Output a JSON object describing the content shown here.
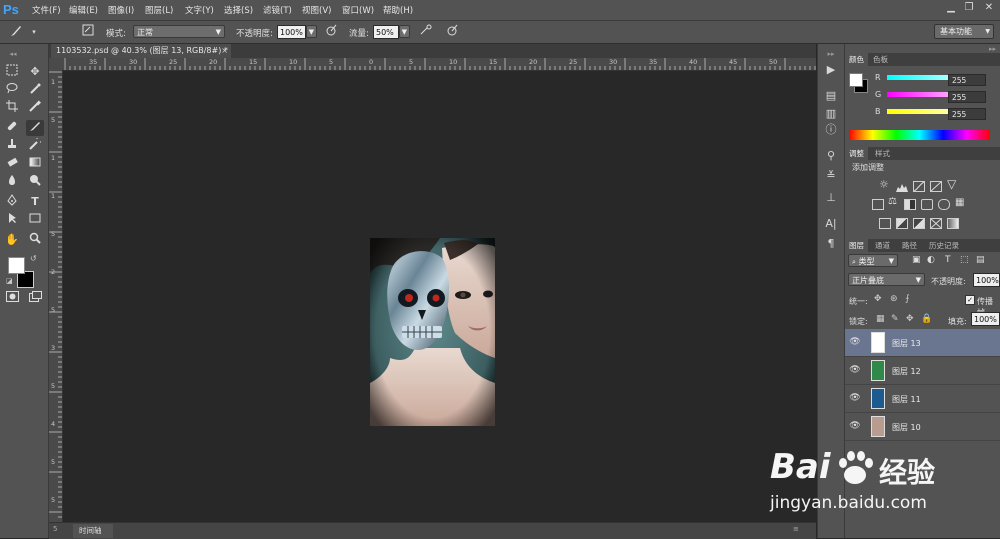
{
  "app": {
    "logo": "Ps"
  },
  "menu": [
    "文件(F)",
    "编辑(E)",
    "图像(I)",
    "图层(L)",
    "文字(Y)",
    "选择(S)",
    "滤镜(T)",
    "视图(V)",
    "窗口(W)",
    "帮助(H)"
  ],
  "window_controls": {
    "minimize": "▁",
    "restore": "❐",
    "close": "✕"
  },
  "options": {
    "brush_size": "57",
    "mode_label": "模式:",
    "mode_value": "正常",
    "opacity_label": "不透明度:",
    "opacity_value": "100%",
    "flow_label": "流量:",
    "flow_value": "50%",
    "workspace": "基本功能"
  },
  "document": {
    "tab_title": "1103532.psd @ 40.3% (图层 13, RGB/8#) *",
    "tab_close": "×",
    "ruler_h": [
      "35",
      "30",
      "25",
      "20",
      "15",
      "10",
      "5",
      "0",
      "5",
      "10",
      "15",
      "20",
      "25",
      "30",
      "35",
      "40",
      "45",
      "50"
    ],
    "ruler_v": [
      "1",
      "5",
      "1",
      "1",
      "5",
      "2",
      "5",
      "3",
      "5",
      "4",
      "5",
      "5"
    ],
    "timeline_label": "时间轴"
  },
  "color_panel": {
    "tabs": [
      "颜色",
      "色板"
    ],
    "channels": [
      {
        "label": "R",
        "value": "255"
      },
      {
        "label": "G",
        "value": "255"
      },
      {
        "label": "B",
        "value": "255"
      }
    ]
  },
  "adjust_panel": {
    "tabs": [
      "调整",
      "样式"
    ],
    "title": "添加调整"
  },
  "layers_panel": {
    "tabs": [
      "图层",
      "通道",
      "路径",
      "历史记录"
    ],
    "filter_kind": "类型",
    "blend_mode": "正片叠底",
    "opacity_label": "不透明度:",
    "opacity_value": "100%",
    "unify_label": "统一:",
    "propagate_label": "传播帧",
    "lock_label": "锁定:",
    "fill_label": "填充:",
    "fill_value": "100%",
    "layers": [
      {
        "name": "图层 13",
        "thumb": "#ffffff",
        "selected": true
      },
      {
        "name": "图层 12",
        "thumb": "#2f8a4a",
        "selected": false
      },
      {
        "name": "图层 11",
        "thumb": "#1d5a8f",
        "selected": false
      },
      {
        "name": "图层 10",
        "thumb": "#b89c90",
        "selected": false
      }
    ]
  },
  "watermark": {
    "brand": "Bai",
    "brand_cn": "经验",
    "url": "jingyan.baidu.com"
  },
  "colors": {
    "selected_layer": "#6a7590",
    "ps_blue": "#3fa5ff"
  }
}
